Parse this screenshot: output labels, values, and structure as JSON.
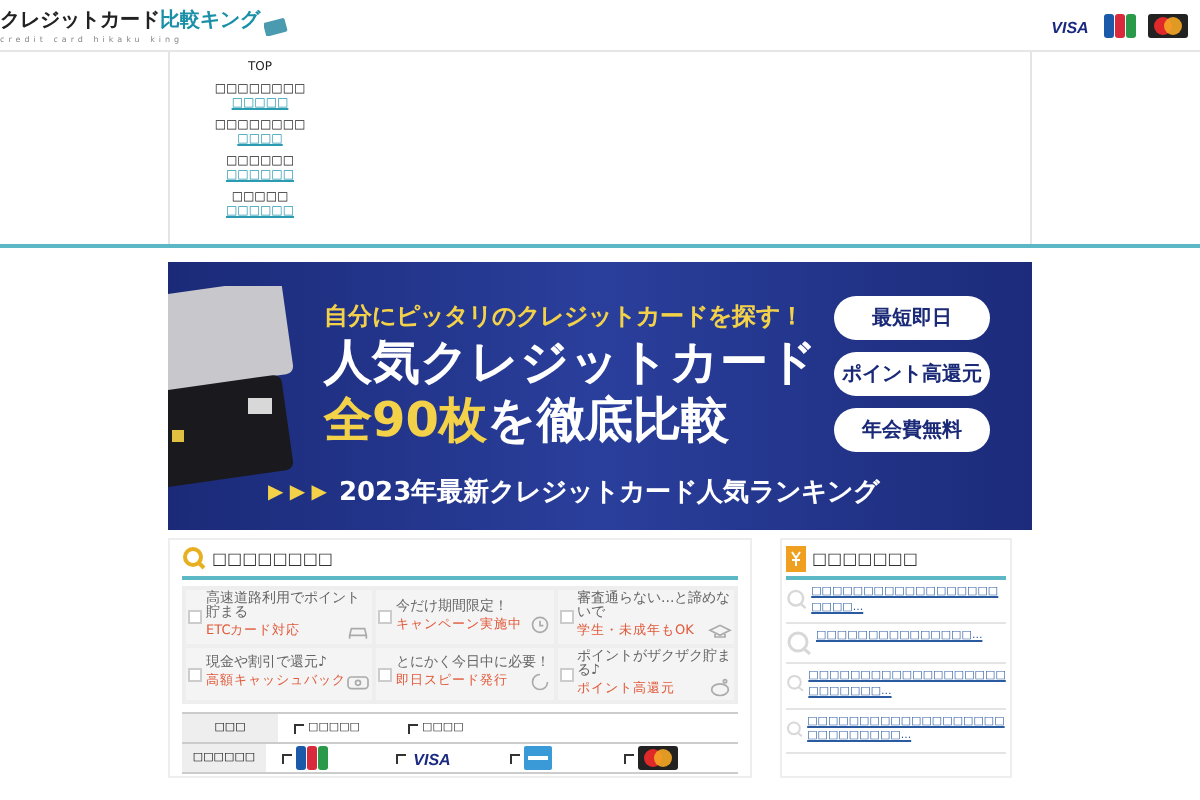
{
  "header": {
    "logo_main": "クレジットカード",
    "logo_accent": "比較キング",
    "logo_sub": "credit card hikaku king",
    "brands": [
      {
        "kind": "visa",
        "label": "VISA"
      },
      {
        "kind": "jcb"
      },
      {
        "kind": "master"
      }
    ]
  },
  "nav": [
    {
      "title": "TOP"
    },
    {
      "title": "□□□□□□□□",
      "link": "□□□□□"
    },
    {
      "title": "□□□□□□□□",
      "link": "□□□□"
    },
    {
      "title": "□□□□□□",
      "link": "□□□□□□"
    },
    {
      "title": "□□□□□",
      "link": "□□□□□□"
    }
  ],
  "banner": {
    "lead": "自分にピッタリのクレジットカードを探す！",
    "headline": "人気クレジットカード",
    "count": "全90枚",
    "headline_rest": "を徹底比較",
    "arrows": "▶ ▶ ▶",
    "ranking": "2023年最新クレジットカード人気ランキング",
    "pills": [
      "最短即日",
      "ポイント高還元",
      "年会費無料"
    ]
  },
  "search": {
    "title": "□□□□□□□□",
    "features": [
      {
        "hint": "高速道路利用でポイント貯まる",
        "label": "ETCカード対応",
        "checked": false,
        "kind": "car"
      },
      {
        "hint": "今だけ期間限定！",
        "label": "キャンペーン実施中",
        "checked": false,
        "kind": "clock"
      },
      {
        "hint": "審査通らない...と諦めないで",
        "label": "学生・未成年もOK",
        "checked": false,
        "kind": "cap"
      },
      {
        "hint": "現金や割引で還元♪",
        "label": "高額キャッシュバック",
        "checked": false,
        "kind": "cash"
      },
      {
        "hint": "とにかく今日中に必要！",
        "label": "即日スピード発行",
        "checked": false,
        "kind": "speed"
      },
      {
        "hint": "ポイントがザクザク貯まる♪",
        "label": "ポイント高還元",
        "checked": false,
        "kind": "pig"
      }
    ],
    "rows": [
      {
        "label": "□□□",
        "options": [
          {
            "kind": "text",
            "label": "□□□□□",
            "checked": false
          },
          {
            "kind": "text",
            "label": "□□□□",
            "checked": false
          }
        ]
      },
      {
        "label": "□□□□□□",
        "options": [
          {
            "kind": "jcb",
            "checked": false
          },
          {
            "kind": "visa",
            "label": "VISA",
            "checked": false
          },
          {
            "kind": "amex",
            "checked": false
          },
          {
            "kind": "master",
            "checked": false
          }
        ]
      }
    ]
  },
  "sidebar": {
    "title": "□□□□□□□",
    "items": [
      "□□□□□□□□□□□□□□□□□□□□□□...",
      "□□□□□□□□□□□□□□□...",
      "□□□□□□□□□□□□□□□□□□□□□□□□□□...",
      "□□□□□□□□□□□□□□□□□□□□□□□□□□□□..."
    ]
  }
}
